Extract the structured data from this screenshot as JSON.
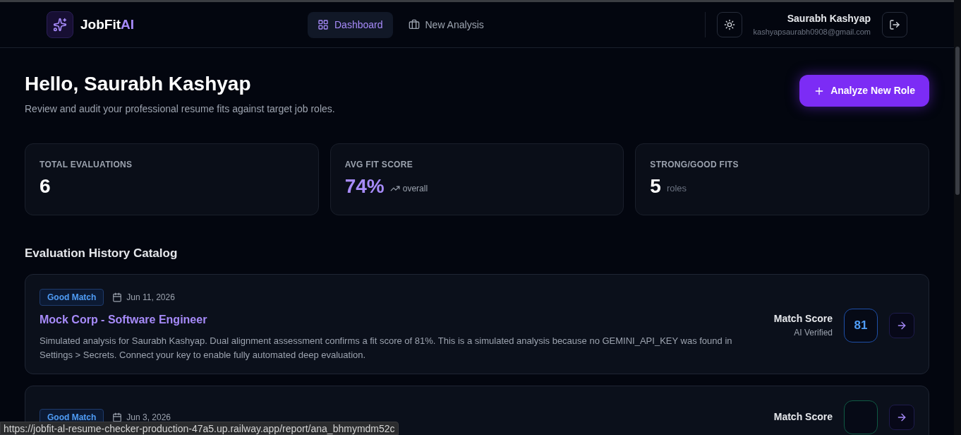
{
  "header": {
    "logo": {
      "name": "JobFit",
      "accent": "AI"
    },
    "nav": [
      {
        "label": "Dashboard",
        "selected": true,
        "kind": "grid"
      },
      {
        "label": "New Analysis",
        "selected": false,
        "kind": "briefcase"
      }
    ],
    "user": {
      "name": "Saurabh Kashyap",
      "email": "kashyapsaurabh0908@gmail.com"
    }
  },
  "greeting": {
    "title": "Hello, Saurabh Kashyap",
    "subtitle": "Review and audit your professional resume fits against target job roles.",
    "button": "Analyze New Role"
  },
  "stats": [
    {
      "label": "TOTAL EVALUATIONS",
      "value": "6",
      "accent": false
    },
    {
      "label": "AVG FIT SCORE",
      "value": "74%",
      "note": "overall",
      "trend": true,
      "accent": true
    },
    {
      "label": "STRONG/GOOD FITS",
      "value": "5",
      "note": "roles",
      "accent": false
    }
  ],
  "history": {
    "title": "Evaluation History Catalog",
    "items": [
      {
        "badge": "Good Match",
        "date": "Jun 11, 2026",
        "title": "Mock Corp - Software Engineer",
        "summary": "Simulated analysis for Saurabh Kashyap. Dual alignment assessment confirms a fit score of 81%. This is a simulated analysis because no GEMINI_API_KEY was found in Settings > Secrets. Connect your key to enable fully automated deep evaluation.",
        "score_label": "Match Score",
        "score_note": "AI Verified",
        "score": "81",
        "color": "#1e4fa8"
      },
      {
        "badge": "Good Match",
        "date": "Jun 3, 2026",
        "score_label": "Match Score",
        "color": "#0f5a44"
      }
    ]
  },
  "status_bar": "https://jobfit-al-resume-checker-production-47a5.up.railway.app/report/ana_bhmymdm52c"
}
